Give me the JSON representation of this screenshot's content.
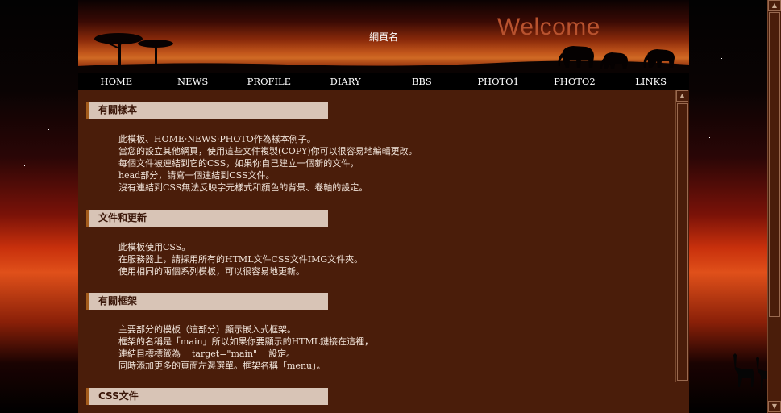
{
  "header": {
    "site_title": "網頁名",
    "welcome": "Welcome"
  },
  "nav": {
    "items": [
      "HOME",
      "NEWS",
      "PROFILE",
      "DIARY",
      "BBS",
      "PHOTO1",
      "PHOTO2",
      "LINKS"
    ]
  },
  "sections": [
    {
      "title": "有關樣本",
      "lines": [
        "此模板、HOME‧NEWS‧PHOTO作為樣本例子。",
        "當您的設立其他網頁，使用這些文件複製(COPY)你可以很容易地編輯更改。",
        "每個文件被連結到它的CSS，如果你自己建立一個新的文件，",
        "head部分，請寫一個連結到CSS文件。",
        "沒有連結到CSS無法反映字元樣式和顏色的背景、卷軸的設定。"
      ]
    },
    {
      "title": "文件和更新",
      "lines": [
        "此模板使用CSS。",
        "在服務器上，請採用所有的HTML文件CSS文件IMG文件夾。",
        "使用相同的兩個系列模板，可以很容易地更新。"
      ]
    },
    {
      "title": "有關框架",
      "lines": [
        "主要部分的模板（這部分）顯示嵌入式框架。",
        "框架的名稱是「main」所以如果你要顯示的HTML鏈接在這裡，",
        "連結目標標籤為    target=\"main\"    設定。",
        "同時添加更多的頁面左邊選單。框架名稱「menu」。"
      ]
    },
    {
      "title": "CSS文件",
      "lines": []
    }
  ],
  "scrollbar": {
    "up_arrow": "▲",
    "down_arrow": "▼"
  },
  "colors": {
    "content_bg": "#4a1d0a",
    "section_bar": "#d8c4b6",
    "section_accent": "#a45c1c",
    "nav_bg": "#000000",
    "welcome": "#b8522e",
    "text": "#f1e4da"
  },
  "icons": [
    "acacia-tree-icon",
    "elephant-icon",
    "giraffe-icon"
  ]
}
